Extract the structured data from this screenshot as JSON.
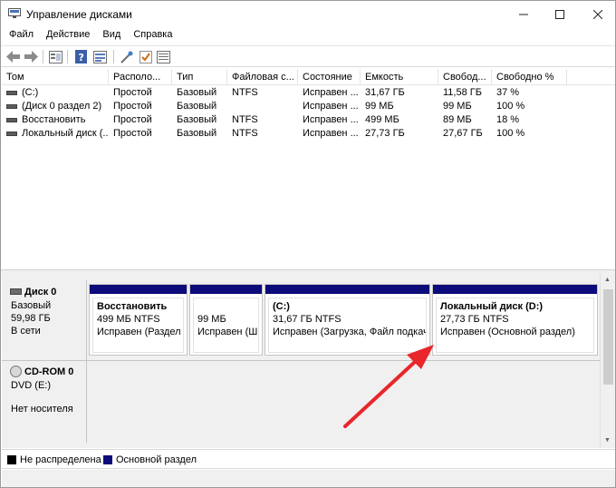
{
  "window": {
    "title": "Управление дисками",
    "controls": {
      "minimize": "—",
      "maximize": "☐",
      "close": "✕"
    }
  },
  "menu": [
    "Файл",
    "Действие",
    "Вид",
    "Справка"
  ],
  "toolbar": {
    "icons": [
      "back-icon",
      "forward-icon",
      "disk-list-icon",
      "help-icon",
      "properties-icon",
      "check-icon",
      "settings-icon"
    ]
  },
  "volume_list": {
    "columns": [
      "Том",
      "Располо...",
      "Тип",
      "Файловая с...",
      "Состояние",
      "Емкость",
      "Свобод...",
      "Свободно %"
    ],
    "rows": [
      [
        "(C:)",
        "Простой",
        "Базовый",
        "NTFS",
        "Исправен ...",
        "31,67 ГБ",
        "11,58 ГБ",
        "37 %"
      ],
      [
        "(Диск 0 раздел 2)",
        "Простой",
        "Базовый",
        "",
        "Исправен ...",
        "99 МБ",
        "99 МБ",
        "100 %"
      ],
      [
        "Восстановить",
        "Простой",
        "Базовый",
        "NTFS",
        "Исправен ...",
        "499 МБ",
        "89 МБ",
        "18 %"
      ],
      [
        "Локальный диск (...",
        "Простой",
        "Базовый",
        "NTFS",
        "Исправен ...",
        "27,73 ГБ",
        "27,67 ГБ",
        "100 %"
      ]
    ]
  },
  "disks": [
    {
      "name": "Диск 0",
      "type": "Базовый",
      "size": "59,98 ГБ",
      "status": "В сети",
      "partitions": [
        {
          "title": "Восстановить",
          "size": "499 МБ NTFS",
          "status": "Исправен (Раздел и"
        },
        {
          "title": "",
          "size": "99 МБ",
          "status": "Исправен (Ш"
        },
        {
          "title": "(C:)",
          "size": "31,67 ГБ NTFS",
          "status": "Исправен (Загрузка, Файл подкач"
        },
        {
          "title": "Локальный диск  (D:)",
          "size": "27,73 ГБ NTFS",
          "status": "Исправен (Основной раздел)"
        }
      ]
    },
    {
      "name": "CD-ROM 0",
      "type": "DVD (E:)",
      "size": "",
      "status": "Нет носителя"
    }
  ],
  "legend": [
    {
      "label": "Не распределена",
      "color": "#000000"
    },
    {
      "label": "Основной раздел",
      "color": "#0b0b79"
    }
  ],
  "annotation": {
    "color": "#e8262b"
  }
}
